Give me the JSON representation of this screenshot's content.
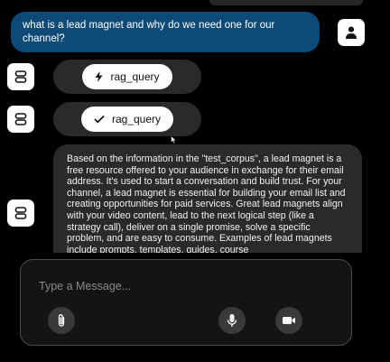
{
  "conversation": {
    "user_message": "what is a lead magnet and why do we need one for our channel?",
    "tool_calls": [
      {
        "label": "rag_query",
        "icon": "lightning-icon"
      },
      {
        "label": "rag_query",
        "icon": "check-icon"
      }
    ],
    "assistant_message": "Based on the information in the \"test_corpus\", a lead magnet is a free resource offered to your audience in exchange for their email address. It's used to start a conversation and build trust. For your channel, a lead magnet is essential for building your email list and creating opportunities for paid services. Great lead magnets align with your video content, lead to the next logical step (like a strategy call), deliver on a single promise, solve a specific problem, and are easy to consume. Examples of lead magnets include prompts, templates, guides, course"
  },
  "composer": {
    "placeholder": "Type a Message...",
    "value": "",
    "icons": [
      "paperclip-icon",
      "microphone-icon",
      "video-camera-icon"
    ]
  },
  "colors": {
    "user_bubble": "#0d4a78",
    "assistant_bubble": "#2a2a2a",
    "background": "#000000"
  }
}
